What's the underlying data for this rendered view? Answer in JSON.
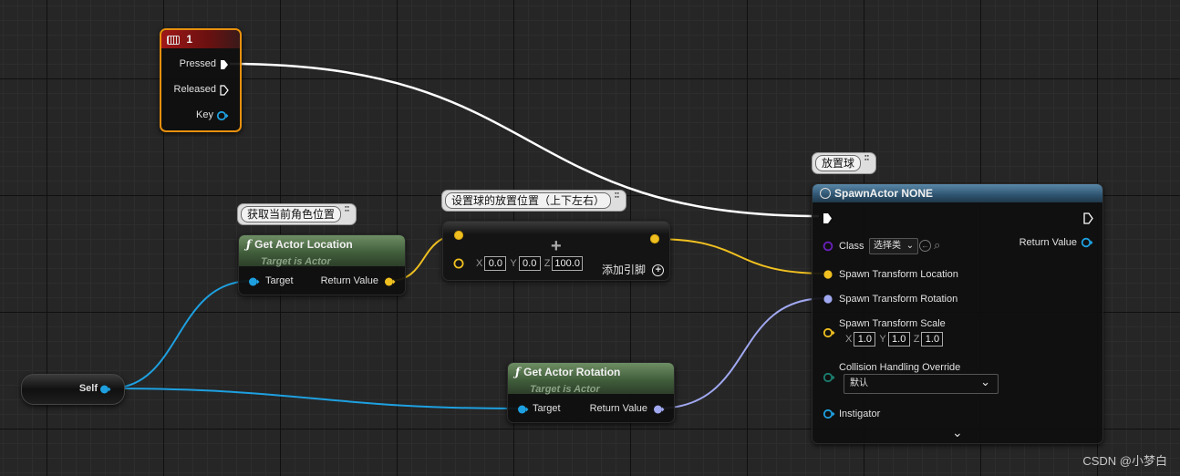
{
  "event_node": {
    "title": "1",
    "icon": "keyboard-icon",
    "pins": {
      "pressed": "Pressed",
      "released": "Released",
      "key": "Key"
    }
  },
  "self_node": {
    "label": "Self"
  },
  "get_location": {
    "comment": "获取当前角色位置",
    "title": "Get Actor Location",
    "subtitle": "Target is Actor",
    "target_label": "Target",
    "return_label": "Return Value"
  },
  "add_vector": {
    "comment": "设置球的放置位置（上下左右）",
    "x_label": "X",
    "x_value": "0.0",
    "y_label": "Y",
    "y_value": "0.0",
    "z_label": "Z",
    "z_value": "100.0",
    "add_pin_label": "添加引脚",
    "plus_symbol": "+"
  },
  "get_rotation": {
    "title": "Get Actor Rotation",
    "subtitle": "Target is Actor",
    "target_label": "Target",
    "return_label": "Return Value"
  },
  "spawn_node": {
    "comment": "放置球",
    "title": "SpawnActor NONE",
    "class_label": "Class",
    "class_value": "选择类",
    "return_label": "Return Value",
    "location_label": "Spawn Transform Location",
    "rotation_label": "Spawn Transform Rotation",
    "scale_label": "Spawn Transform Scale",
    "scale_x_label": "X",
    "scale_x": "1.0",
    "scale_y_label": "Y",
    "scale_y": "1.0",
    "scale_z_label": "Z",
    "scale_z": "1.0",
    "collision_label": "Collision Handling Override",
    "collision_value": "默认",
    "instigator_label": "Instigator"
  },
  "watermark": "CSDN @小梦白",
  "colors": {
    "exec": "#ffffff",
    "object": "#1ea0e0",
    "vector": "#f0c020",
    "rotator": "#a0a8f0",
    "byte": "#1a8070",
    "class": "#6a20c0",
    "event_border": "#e8900e",
    "event_header": "#9a1010",
    "spawn_header": "#3a6888"
  }
}
